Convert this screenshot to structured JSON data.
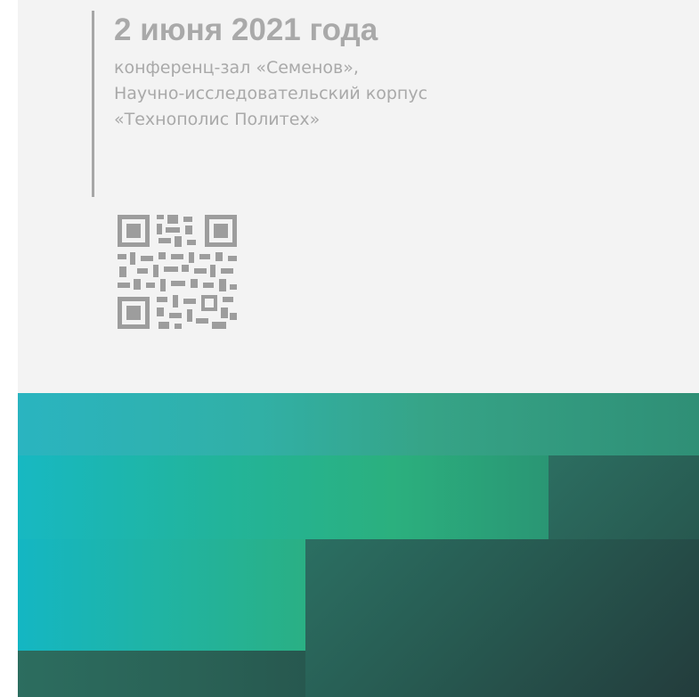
{
  "event": {
    "date": "2 июня 2021 года",
    "venue_lines": [
      "конференц-зал «Семенов»,",
      "Научно-исследовательский корпус",
      "«Технополис Политех»"
    ]
  },
  "qr_code": {
    "icon": "qr-code-icon"
  },
  "colors": {
    "page_background": "#f3f3f3",
    "text_gray": "#a9a9a9",
    "accent_turquoise": "#17b8c2",
    "accent_green": "#2bb07e",
    "dark_teal": "#27584f"
  }
}
